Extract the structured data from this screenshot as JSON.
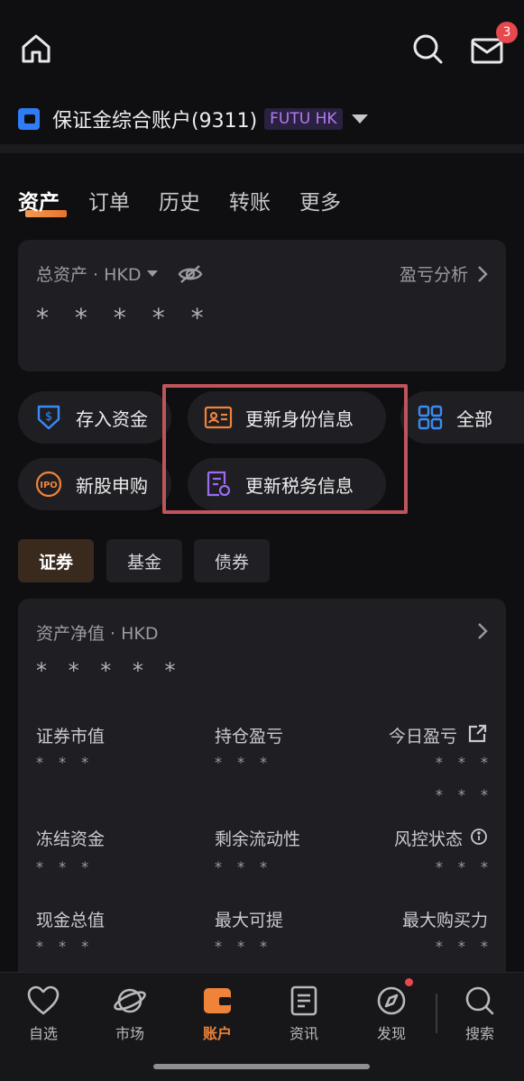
{
  "header": {
    "mail_badge": "3"
  },
  "account": {
    "name": "保证金综合账户(9311)",
    "tag": "FUTU HK"
  },
  "tabs": [
    {
      "label": "资产",
      "active": true
    },
    {
      "label": "订单"
    },
    {
      "label": "历史"
    },
    {
      "label": "转账"
    },
    {
      "label": "更多"
    }
  ],
  "total_assets": {
    "label": "总资产 · HKD",
    "analysis_link": "盈亏分析",
    "masked_value": "* * * * *"
  },
  "shortcuts": {
    "deposit": "存入资金",
    "update_identity": "更新身份信息",
    "all": "全部",
    "ipo": "新股申购",
    "update_tax": "更新税务信息",
    "ipo_icon_text": "IPO"
  },
  "segments": [
    {
      "label": "证券",
      "active": true
    },
    {
      "label": "基金"
    },
    {
      "label": "债券"
    }
  ],
  "net_assets": {
    "label": "资产净值 · HKD",
    "masked_value": "* * * * *",
    "stats": {
      "securities_value": {
        "label": "证券市值",
        "value": "* * *"
      },
      "position_pl": {
        "label": "持仓盈亏",
        "value": "* * *"
      },
      "today_pl": {
        "label": "今日盈亏",
        "value": "* * *",
        "value2": "* * *"
      },
      "frozen_funds": {
        "label": "冻结资金",
        "value": "* * *"
      },
      "remaining_liquidity": {
        "label": "剩余流动性",
        "value": "* * *"
      },
      "risk_status": {
        "label": "风控状态",
        "value": "* * *"
      },
      "total_cash": {
        "label": "现金总值",
        "value": "* * *"
      },
      "max_withdraw": {
        "label": "最大可提",
        "value": "* * *"
      },
      "max_buying_power": {
        "label": "最大购买力",
        "value": "* * *"
      }
    }
  },
  "bottom_nav": [
    {
      "label": "自选",
      "icon": "heart-icon"
    },
    {
      "label": "市场",
      "icon": "planet-icon"
    },
    {
      "label": "账户",
      "icon": "wallet-icon",
      "active": true
    },
    {
      "label": "资讯",
      "icon": "news-icon"
    },
    {
      "label": "发现",
      "icon": "compass-icon"
    },
    {
      "label": "搜索",
      "icon": "search-icon"
    }
  ],
  "colors": {
    "accent": "#f0833a",
    "highlight_border": "#c0545b",
    "background": "#0f0f11",
    "card": "#1f1f23"
  }
}
